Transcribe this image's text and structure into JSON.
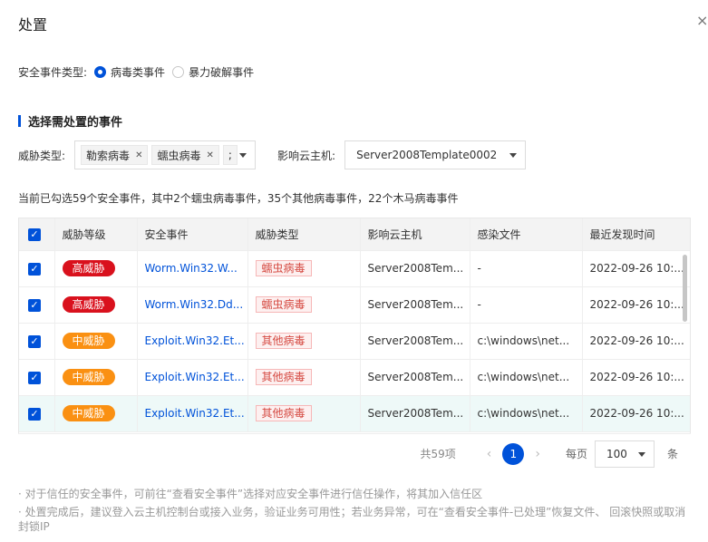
{
  "dialog": {
    "title": "处置",
    "close_icon": "×"
  },
  "event_type": {
    "label": "安全事件类型:",
    "options": [
      {
        "label": "病毒类事件",
        "selected": true
      },
      {
        "label": "暴力破解事件",
        "selected": false
      }
    ]
  },
  "section_title": "选择需处置的事件",
  "filters": {
    "threat_label": "威胁类型:",
    "threat_tags": [
      "勒索病毒",
      "蠕虫病毒",
      " ;"
    ],
    "host_label": "影响云主机:",
    "host_value": "Server2008Template0002"
  },
  "summary": "当前已勾选59个安全事件，其中2个蠕虫病毒事件，35个其他病毒事件，22个木马病毒事件",
  "table": {
    "headers": [
      "威胁等级",
      "安全事件",
      "威胁类型",
      "影响云主机",
      "感染文件",
      "最近发现时间"
    ],
    "rows": [
      {
        "level": "高威胁",
        "level_type": "high",
        "event": "Worm.Win32.W...",
        "threat": "蠕虫病毒",
        "host": "Server2008Tem...",
        "file": "-",
        "time": "2022-09-26 10:..."
      },
      {
        "level": "高威胁",
        "level_type": "high",
        "event": "Worm.Win32.Dd...",
        "threat": "蠕虫病毒",
        "host": "Server2008Tem...",
        "file": "-",
        "time": "2022-09-26 10:..."
      },
      {
        "level": "中威胁",
        "level_type": "mid",
        "event": "Exploit.Win32.Et...",
        "threat": "其他病毒",
        "host": "Server2008Tem...",
        "file": "c:\\windows\\net...",
        "time": "2022-09-26 10:..."
      },
      {
        "level": "中威胁",
        "level_type": "mid",
        "event": "Exploit.Win32.Et...",
        "threat": "其他病毒",
        "host": "Server2008Tem...",
        "file": "c:\\windows\\net...",
        "time": "2022-09-26 10:..."
      },
      {
        "level": "中威胁",
        "level_type": "mid",
        "event": "Exploit.Win32.Et...",
        "threat": "其他病毒",
        "host": "Server2008Tem...",
        "file": "c:\\windows\\net...",
        "time": "2022-09-26 10:..."
      }
    ]
  },
  "pagination": {
    "total": "共59项",
    "current_page": "1",
    "per_label": "每页",
    "page_size": "100",
    "unit": "条"
  },
  "notes": [
    "· 对于信任的安全事件，可前往“查看安全事件”选择对应安全事件进行信任操作，将其加入信任区",
    "· 处置完成后，建议登入云主机控制台或接入业务，验证业务可用性；若业务异常，可在“查看安全事件-已处理”恢复文件、 回滚快照或取消封锁IP"
  ],
  "colors": {
    "accent": "#0052d9",
    "high": "#d9111d",
    "mid": "#fa9012"
  }
}
